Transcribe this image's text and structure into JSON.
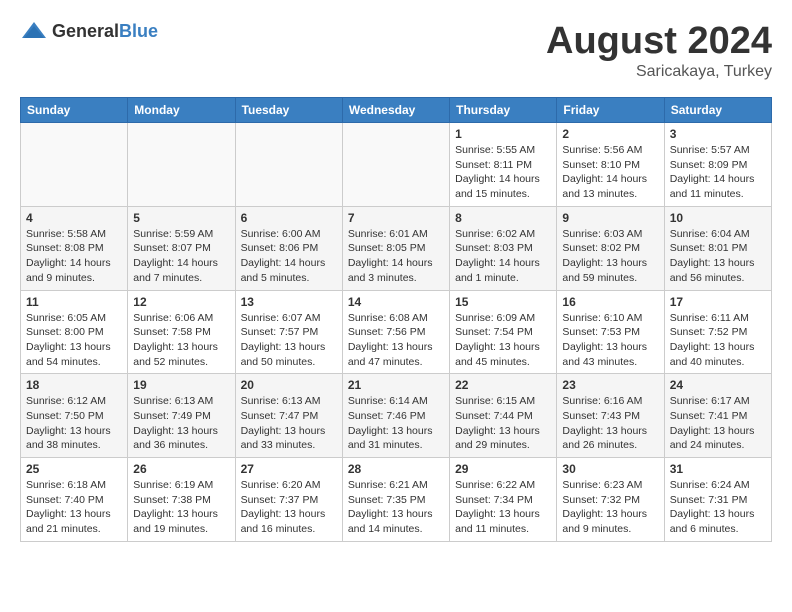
{
  "header": {
    "logo_general": "General",
    "logo_blue": "Blue",
    "title": "August 2024",
    "location": "Saricakaya, Turkey"
  },
  "weekdays": [
    "Sunday",
    "Monday",
    "Tuesday",
    "Wednesday",
    "Thursday",
    "Friday",
    "Saturday"
  ],
  "weeks": [
    [
      {
        "day": "",
        "info": ""
      },
      {
        "day": "",
        "info": ""
      },
      {
        "day": "",
        "info": ""
      },
      {
        "day": "",
        "info": ""
      },
      {
        "day": "1",
        "info": "Sunrise: 5:55 AM\nSunset: 8:11 PM\nDaylight: 14 hours and 15 minutes."
      },
      {
        "day": "2",
        "info": "Sunrise: 5:56 AM\nSunset: 8:10 PM\nDaylight: 14 hours and 13 minutes."
      },
      {
        "day": "3",
        "info": "Sunrise: 5:57 AM\nSunset: 8:09 PM\nDaylight: 14 hours and 11 minutes."
      }
    ],
    [
      {
        "day": "4",
        "info": "Sunrise: 5:58 AM\nSunset: 8:08 PM\nDaylight: 14 hours and 9 minutes."
      },
      {
        "day": "5",
        "info": "Sunrise: 5:59 AM\nSunset: 8:07 PM\nDaylight: 14 hours and 7 minutes."
      },
      {
        "day": "6",
        "info": "Sunrise: 6:00 AM\nSunset: 8:06 PM\nDaylight: 14 hours and 5 minutes."
      },
      {
        "day": "7",
        "info": "Sunrise: 6:01 AM\nSunset: 8:05 PM\nDaylight: 14 hours and 3 minutes."
      },
      {
        "day": "8",
        "info": "Sunrise: 6:02 AM\nSunset: 8:03 PM\nDaylight: 14 hours and 1 minute."
      },
      {
        "day": "9",
        "info": "Sunrise: 6:03 AM\nSunset: 8:02 PM\nDaylight: 13 hours and 59 minutes."
      },
      {
        "day": "10",
        "info": "Sunrise: 6:04 AM\nSunset: 8:01 PM\nDaylight: 13 hours and 56 minutes."
      }
    ],
    [
      {
        "day": "11",
        "info": "Sunrise: 6:05 AM\nSunset: 8:00 PM\nDaylight: 13 hours and 54 minutes."
      },
      {
        "day": "12",
        "info": "Sunrise: 6:06 AM\nSunset: 7:58 PM\nDaylight: 13 hours and 52 minutes."
      },
      {
        "day": "13",
        "info": "Sunrise: 6:07 AM\nSunset: 7:57 PM\nDaylight: 13 hours and 50 minutes."
      },
      {
        "day": "14",
        "info": "Sunrise: 6:08 AM\nSunset: 7:56 PM\nDaylight: 13 hours and 47 minutes."
      },
      {
        "day": "15",
        "info": "Sunrise: 6:09 AM\nSunset: 7:54 PM\nDaylight: 13 hours and 45 minutes."
      },
      {
        "day": "16",
        "info": "Sunrise: 6:10 AM\nSunset: 7:53 PM\nDaylight: 13 hours and 43 minutes."
      },
      {
        "day": "17",
        "info": "Sunrise: 6:11 AM\nSunset: 7:52 PM\nDaylight: 13 hours and 40 minutes."
      }
    ],
    [
      {
        "day": "18",
        "info": "Sunrise: 6:12 AM\nSunset: 7:50 PM\nDaylight: 13 hours and 38 minutes."
      },
      {
        "day": "19",
        "info": "Sunrise: 6:13 AM\nSunset: 7:49 PM\nDaylight: 13 hours and 36 minutes."
      },
      {
        "day": "20",
        "info": "Sunrise: 6:13 AM\nSunset: 7:47 PM\nDaylight: 13 hours and 33 minutes."
      },
      {
        "day": "21",
        "info": "Sunrise: 6:14 AM\nSunset: 7:46 PM\nDaylight: 13 hours and 31 minutes."
      },
      {
        "day": "22",
        "info": "Sunrise: 6:15 AM\nSunset: 7:44 PM\nDaylight: 13 hours and 29 minutes."
      },
      {
        "day": "23",
        "info": "Sunrise: 6:16 AM\nSunset: 7:43 PM\nDaylight: 13 hours and 26 minutes."
      },
      {
        "day": "24",
        "info": "Sunrise: 6:17 AM\nSunset: 7:41 PM\nDaylight: 13 hours and 24 minutes."
      }
    ],
    [
      {
        "day": "25",
        "info": "Sunrise: 6:18 AM\nSunset: 7:40 PM\nDaylight: 13 hours and 21 minutes."
      },
      {
        "day": "26",
        "info": "Sunrise: 6:19 AM\nSunset: 7:38 PM\nDaylight: 13 hours and 19 minutes."
      },
      {
        "day": "27",
        "info": "Sunrise: 6:20 AM\nSunset: 7:37 PM\nDaylight: 13 hours and 16 minutes."
      },
      {
        "day": "28",
        "info": "Sunrise: 6:21 AM\nSunset: 7:35 PM\nDaylight: 13 hours and 14 minutes."
      },
      {
        "day": "29",
        "info": "Sunrise: 6:22 AM\nSunset: 7:34 PM\nDaylight: 13 hours and 11 minutes."
      },
      {
        "day": "30",
        "info": "Sunrise: 6:23 AM\nSunset: 7:32 PM\nDaylight: 13 hours and 9 minutes."
      },
      {
        "day": "31",
        "info": "Sunrise: 6:24 AM\nSunset: 7:31 PM\nDaylight: 13 hours and 6 minutes."
      }
    ]
  ]
}
